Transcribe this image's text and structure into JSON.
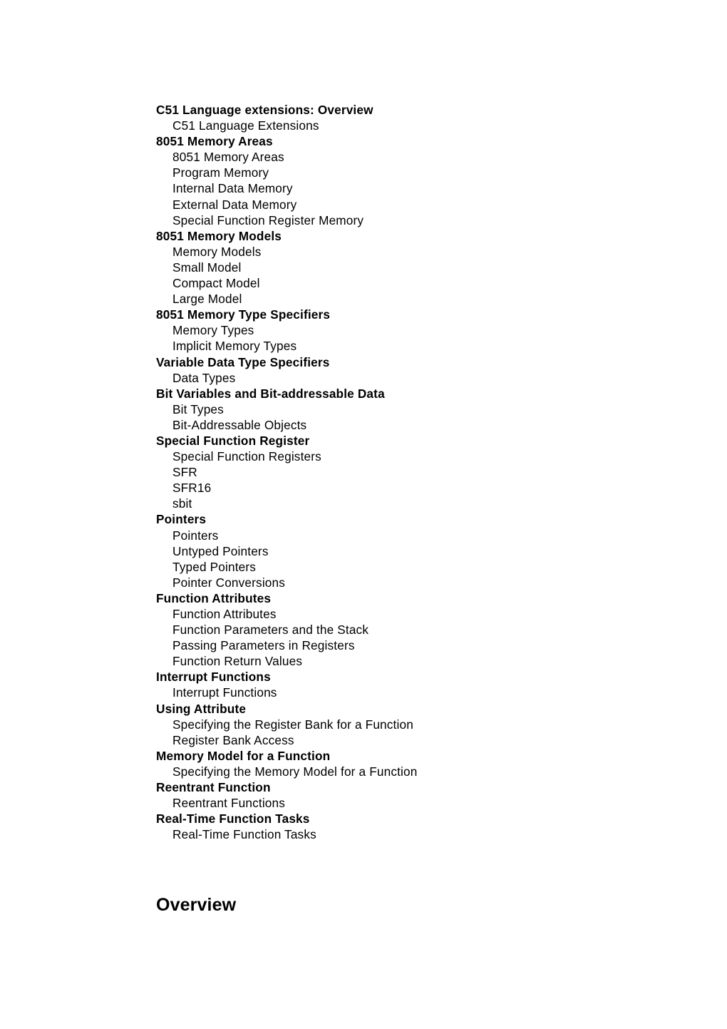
{
  "page": {
    "background_color": "#ffffff",
    "text_color": "#000000"
  },
  "toc": {
    "entries": [
      {
        "label": "C51 Language extensions: Overview",
        "level": 1
      },
      {
        "label": "C51 Language Extensions",
        "level": 2
      },
      {
        "label": "8051 Memory Areas",
        "level": 1
      },
      {
        "label": "8051 Memory Areas",
        "level": 2
      },
      {
        "label": "Program Memory",
        "level": 2
      },
      {
        "label": "Internal Data Memory",
        "level": 2
      },
      {
        "label": "External Data Memory",
        "level": 2
      },
      {
        "label": "Special Function Register Memory",
        "level": 2
      },
      {
        "label": "8051 Memory Models",
        "level": 1
      },
      {
        "label": "Memory Models",
        "level": 2
      },
      {
        "label": "Small Model",
        "level": 2
      },
      {
        "label": "Compact Model",
        "level": 2
      },
      {
        "label": "Large Model",
        "level": 2
      },
      {
        "label": "8051 Memory Type Specifiers",
        "level": 1
      },
      {
        "label": "Memory Types",
        "level": 2
      },
      {
        "label": "Implicit Memory Types",
        "level": 2
      },
      {
        "label": "Variable Data Type Specifiers",
        "level": 1
      },
      {
        "label": "Data Types",
        "level": 2
      },
      {
        "label": "Bit Variables and Bit-addressable Data",
        "level": 1
      },
      {
        "label": "Bit Types",
        "level": 2
      },
      {
        "label": "Bit-Addressable Objects",
        "level": 2
      },
      {
        "label": "Special Function Register",
        "level": 1
      },
      {
        "label": "Special Function Registers",
        "level": 2
      },
      {
        "label": "SFR",
        "level": 2
      },
      {
        "label": "SFR16",
        "level": 2
      },
      {
        "label": "sbit",
        "level": 2
      },
      {
        "label": "Pointers",
        "level": 1
      },
      {
        "label": "Pointers",
        "level": 2
      },
      {
        "label": "Untyped Pointers",
        "level": 2
      },
      {
        "label": "Typed Pointers",
        "level": 2
      },
      {
        "label": "Pointer Conversions",
        "level": 2
      },
      {
        "label": "Function Attributes",
        "level": 1
      },
      {
        "label": "Function Attributes",
        "level": 2
      },
      {
        "label": "Function Parameters and the Stack",
        "level": 2
      },
      {
        "label": "Passing Parameters in Registers",
        "level": 2
      },
      {
        "label": "Function Return Values",
        "level": 2
      },
      {
        "label": "Interrupt Functions",
        "level": 1
      },
      {
        "label": "Interrupt Functions",
        "level": 2
      },
      {
        "label": "Using Attribute",
        "level": 1
      },
      {
        "label": "Specifying the Register Bank for a Function",
        "level": 2
      },
      {
        "label": "Register Bank Access",
        "level": 2
      },
      {
        "label": "Memory Model for a Function",
        "level": 1
      },
      {
        "label": "Specifying the Memory Model for a Function",
        "level": 2
      },
      {
        "label": "Reentrant Function",
        "level": 1
      },
      {
        "label": "Reentrant Functions",
        "level": 2
      },
      {
        "label": "Real-Time Function Tasks",
        "level": 1
      },
      {
        "label": "Real-Time Function Tasks",
        "level": 2
      }
    ]
  },
  "chapter": {
    "heading": "Overview"
  }
}
